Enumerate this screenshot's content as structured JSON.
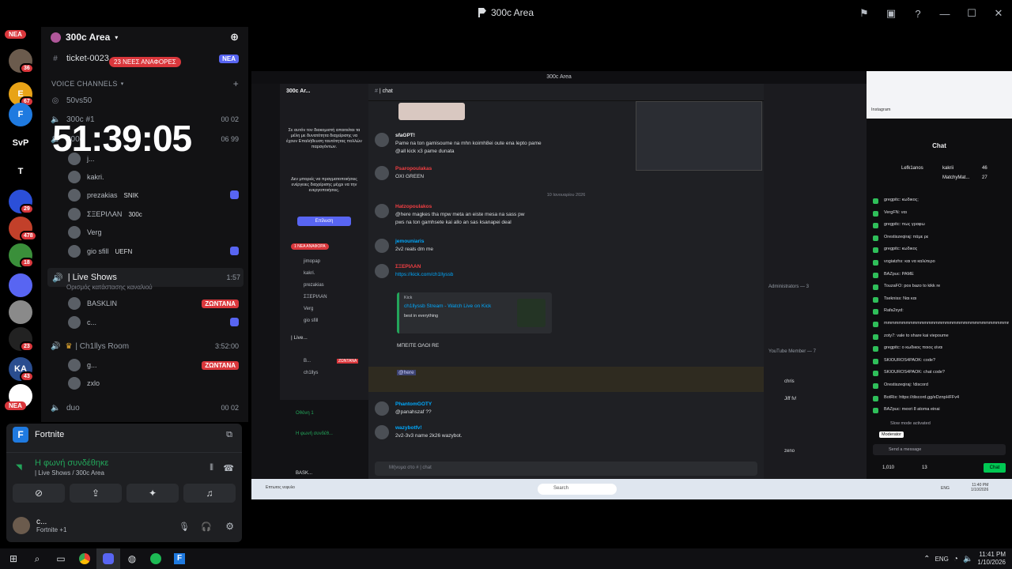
{
  "window": {
    "title": "300c Area"
  },
  "rail": {
    "nea_top": "NEA",
    "nea_bottom": "NEA",
    "items": [
      {
        "label": "",
        "badge": "36",
        "color": "#6b5b4d"
      },
      {
        "label": "E",
        "badge": "67",
        "color": "#e8a317"
      },
      {
        "label": "F",
        "badge": "",
        "color": "#1f7ae0"
      },
      {
        "label": "SvP",
        "badge": "",
        "color": "#000000"
      },
      {
        "label": "T",
        "badge": "",
        "color": "#000000"
      },
      {
        "label": "",
        "badge": "29",
        "color": "#2b4fd8"
      },
      {
        "label": "",
        "badge": "478",
        "color": "#c2402a"
      },
      {
        "label": "",
        "badge": "18",
        "color": "#3a8f3a"
      },
      {
        "label": "",
        "badge": "",
        "color": "#5865f2"
      },
      {
        "label": "",
        "badge": "",
        "color": "#8a8a8a"
      },
      {
        "label": "",
        "badge": "23",
        "color": "#222222"
      },
      {
        "label": "KA",
        "badge": "43",
        "color": "#2a4d8f"
      },
      {
        "label": "",
        "badge": "",
        "color": "#ffffff"
      }
    ]
  },
  "sidebar": {
    "server_name": "300c Area",
    "ticket_channel": "ticket-0023",
    "mentions_pill": "23 ΝΕΕΣ ΑΝΑΦΟΡΕΣ",
    "new_pill": "ΝΕΑ",
    "voice_header": "VOICE CHANNELS",
    "ch_50vs50": "50vs50",
    "ch_300c1": "300c #1",
    "ch_300c1_time": "00  02",
    "ch_300c2": "300c",
    "ch_300c2_time": "06  99",
    "big_timer": "51:39:05",
    "users_a": [
      "j...",
      "kakri.",
      "prezakias",
      "ΣΞΕΡΙΛΑΝ",
      "Verg",
      "gio sfill"
    ],
    "tags_a": [
      "",
      "",
      "SNIK",
      "300c",
      "",
      "UEFN"
    ],
    "live_shows": "| Live Shows",
    "live_shows_time": "1:57",
    "live_status": "Ορισμός κατάστασης καναλιού",
    "users_b": [
      "BASKLIN",
      "c..."
    ],
    "live_badge": "ΖΩΝΤΑΝΑ",
    "chillys_room": "| Ch1llys Room",
    "chillys_time": "3:52:00",
    "users_c": [
      "g...",
      "zxlo"
    ],
    "duo": "duo",
    "duo_time": "00  02"
  },
  "panel": {
    "activity_title": "Fortnite",
    "voice_connected": "Η φωνή συνδέθηκε",
    "voice_location": "| Live Shows / 300c Area",
    "user_name": "c...",
    "user_status": "Fortnite +1"
  },
  "stream": {
    "title": "300c Area",
    "server_name": "300c Ar...",
    "channel": "| chat",
    "verify_text": "Σε αυτόν τον διακομιστή απαιτείται τα μέλη με δυνατότητα διαχείρισης να έχουν Επαλήθευση ταυτότητας πολλών παραγόντων.",
    "verify_text2": "Δεν μπορείς να πραγματοποιήσεις ενέργειες διαχείρισης μέχρι να την ενεργοποιήσεις.",
    "verify_button": "Επίλυση",
    "new_mentions": "1 ΝΕΑ ΑΝΑΦΟΡΑ",
    "side_users": [
      "jimopap",
      "kakri.",
      "prezakias",
      "ΣΞΕΡΙΛΑΝ",
      "Verg",
      "gio sfill"
    ],
    "side_live": "| Live...",
    "side_live_users": [
      "B...",
      "ch1llys"
    ],
    "side_live_badge": "ΖΩΝΤΑΝΑ",
    "screen_label": "Οθόνη 1",
    "voice_label": "Η φωνή συνδέθ...",
    "user_label": "BASK...",
    "messages": [
      {
        "name": "sfaGPT!",
        "tag": "300c",
        "text": "Pame na ton gamisoume na mhn koimh8ei oute ena lepto pame",
        "text2": "@all kick x3 pame dunata"
      },
      {
        "name": "Psaropoulakas",
        "tag": "",
        "text": "OXI GREEN",
        "text2": ""
      },
      {
        "name": "Hatzopoulakos",
        "tag": "",
        "text": "@here magkes tha mpw meta an eiste mesa na sass pw",
        "text2": "pws na ton gamhsete kai allo an sas ksanapei deal"
      },
      {
        "name": "jemouniaris",
        "tag": "300c",
        "text": "2v2 reals dm me",
        "text2": ""
      },
      {
        "name": "ΣΞΕΡΙΛΑΝ",
        "tag": "300c",
        "text": "https://kick.com/ch1llyssb",
        "text2": ""
      },
      {
        "name": "PhantomGOTY",
        "tag": "",
        "text": "@panahszaf ??",
        "text2": ""
      },
      {
        "name": "wazybotfv!",
        "tag": "300c",
        "text": "2v2-3v3 name 2k26 wazybot.",
        "text2": ""
      }
    ],
    "date_divider": "10 Ιανουαρίου 2026",
    "embed_site": "Kick",
    "embed_title": "ch1llyssb Stream - Watch Live on Kick",
    "embed_desc": "best in everything",
    "mpeite": "ΜΠΕΙΤΕ ΟΛΟΙ RE",
    "here_msg": "@here",
    "input_placeholder": "Μήνυμα στο # | chat",
    "members_headers": [
      "Administrators — 3",
      "YouTube Member — 7"
    ],
    "members": [
      "chris",
      "Jiff fv!",
      "zeno"
    ],
    "twitch": {
      "chat_title": "Chat",
      "top_users": [
        "Lefk1anos",
        "kakrii",
        "MatchyMat..."
      ],
      "top_counts": [
        "46",
        "27"
      ],
      "lines": [
        "gregpitc: κωδικος;",
        "VergFN: ναι",
        "gregpitc: πως γραφω",
        "Orestiszeqiraj: πάμε ρε",
        "gregpitc: κωδικος",
        "vogiatzhs: και να καλύτερο",
        "BAZpuc: PAME",
        "TouzaFO: pos bazo to kikk re",
        "Tsekniss: Ναι και",
        "Rafa2xyd: ",
        "mmmmmmmmmmmmmmmmmmmmmmmmmmmmmmmmmmmmmmmmm. nl nnlbbl",
        "zoty7: vale to share kai viepoume",
        "gregpitc: ο κωδικος ποιος είναι",
        "SKIOUROS4PAOK: code?",
        "SKIOUROS4PAOK: chat code?",
        "Orestiszeqiraj: !discord",
        "BotRix: https://discord.gg/eDznpHFFv4",
        "BAZpuc: mexri 8 atoma einai"
      ],
      "slow_mode": "Slow mode activated",
      "moderator": "Moderator",
      "send_placeholder": "Send a message",
      "viewers": "1,010",
      "count13": "13",
      "chat_button": "Chat",
      "instagram": "Instagram"
    },
    "inner_taskbar": {
      "search": "Search",
      "time": "11:40 PM",
      "date": "1/10/2026",
      "lang": "ENG",
      "weather": "Επτωτος νεφυλο"
    }
  },
  "taskbar": {
    "time": "11:41 PM",
    "date": "1/10/2026",
    "lang": "ENG"
  }
}
